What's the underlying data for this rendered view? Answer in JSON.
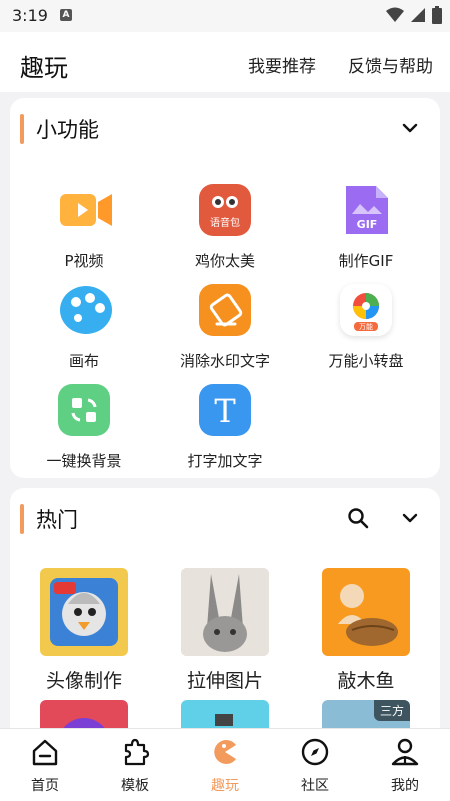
{
  "status": {
    "time": "3:19"
  },
  "header": {
    "title": "趣玩",
    "recommend": "我要推荐",
    "feedback": "反馈与帮助"
  },
  "features": {
    "title": "小功能",
    "items": [
      {
        "label": "P视频",
        "icon": "video-camera-icon",
        "color": "#ffa63a"
      },
      {
        "label": "鸡你太美",
        "icon": "voice-pack-icon",
        "color": "#e25a3e",
        "badge": "语音包"
      },
      {
        "label": "制作GIF",
        "icon": "gif-file-icon",
        "color": "#9b6cf2",
        "badge": "GIF"
      },
      {
        "label": "画布",
        "icon": "palette-icon",
        "color": "#37aef0"
      },
      {
        "label": "消除水印文字",
        "icon": "eraser-icon",
        "color": "#f6901e"
      },
      {
        "label": "万能小转盘",
        "icon": "spin-wheel-icon",
        "color": "#f24e3d",
        "badge": "万能"
      },
      {
        "label": "一键换背景",
        "icon": "swap-background-icon",
        "color": "#5fcf84"
      },
      {
        "label": "打字加文字",
        "icon": "text-t-icon",
        "color": "#3a97ef",
        "badge": "T"
      }
    ]
  },
  "hot": {
    "title": "热门",
    "items": [
      {
        "label": "头像制作",
        "icon": "avatar-maker-icon",
        "color": "#f2c94c"
      },
      {
        "label": "拉伸图片",
        "icon": "stretch-image-icon",
        "color": "#d8cfc6"
      },
      {
        "label": "敲木鱼",
        "icon": "wooden-fish-icon",
        "color": "#f79a1f"
      }
    ],
    "partial_badge": "三方"
  },
  "tabs": [
    {
      "label": "首页",
      "icon": "home-icon"
    },
    {
      "label": "模板",
      "icon": "puzzle-icon"
    },
    {
      "label": "趣玩",
      "icon": "pacman-icon",
      "active": true
    },
    {
      "label": "社区",
      "icon": "compass-icon"
    },
    {
      "label": "我的",
      "icon": "profile-icon"
    }
  ]
}
